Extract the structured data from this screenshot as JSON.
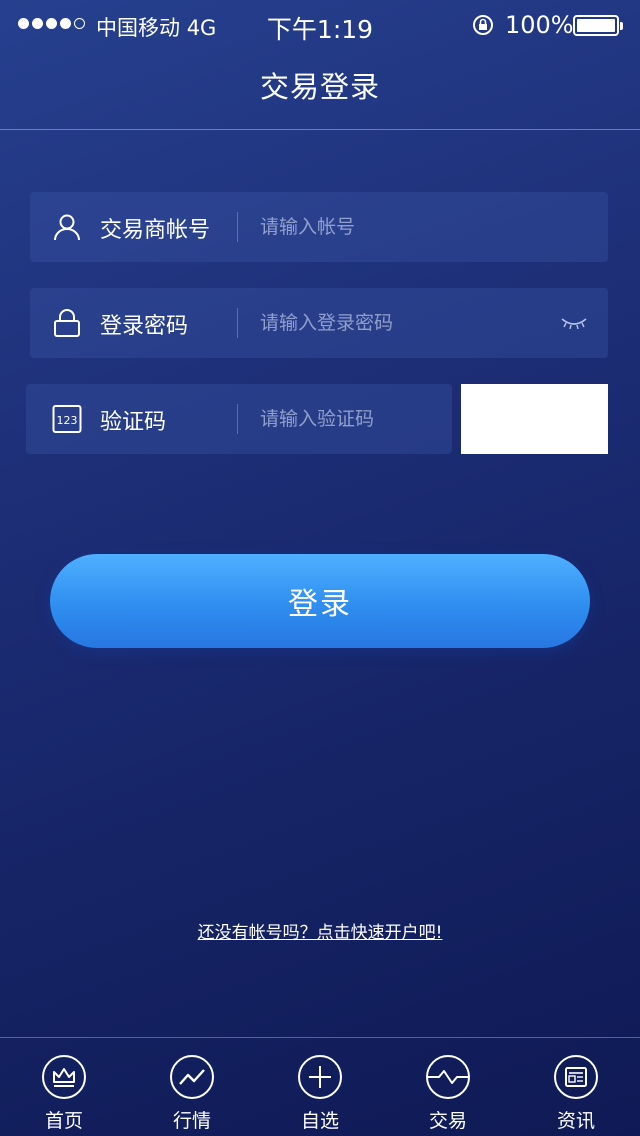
{
  "status_bar": {
    "carrier": "中国移动",
    "network": "4G",
    "time": "下午1:19",
    "battery": "100%"
  },
  "nav": {
    "title": "交易登录"
  },
  "form": {
    "account": {
      "label": "交易商帐号",
      "placeholder": "请输入帐号",
      "value": ""
    },
    "password": {
      "label": "登录密码",
      "placeholder": "请输入登录密码",
      "value": ""
    },
    "captcha": {
      "label": "验证码",
      "placeholder": "请输入验证码",
      "value": "",
      "icon_text": "123"
    },
    "login_label": "登录"
  },
  "signup_link": "还没有帐号吗？点击快速开户吧!",
  "tabs": [
    {
      "label": "首页",
      "icon": "crown-icon"
    },
    {
      "label": "行情",
      "icon": "trend-chart-icon"
    },
    {
      "label": "自选",
      "icon": "plus-circle-icon"
    },
    {
      "label": "交易",
      "icon": "wave-icon"
    },
    {
      "label": "资讯",
      "icon": "news-icon"
    }
  ],
  "colors": {
    "button_top": "#4fb0ff",
    "button_bottom": "#2777e0",
    "background": "#1e2f78"
  }
}
